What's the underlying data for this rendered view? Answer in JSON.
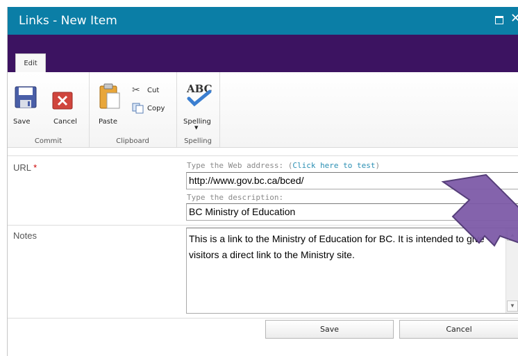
{
  "window": {
    "title": "Links - New Item"
  },
  "ribbon": {
    "tab_edit": "Edit",
    "groups": {
      "commit": {
        "label": "Commit",
        "save": "Save",
        "cancel": "Cancel"
      },
      "clipboard": {
        "label": "Clipboard",
        "paste": "Paste",
        "cut": "Cut",
        "copy": "Copy"
      },
      "spelling": {
        "label": "Spelling",
        "spelling": "Spelling"
      }
    }
  },
  "form": {
    "url": {
      "label": "URL",
      "required_mark": "*",
      "hint_prefix": "Type the Web address: (",
      "hint_link": "Click here to test",
      "hint_suffix": ")",
      "value": "http://www.gov.bc.ca/bced/",
      "desc_hint": "Type the description:",
      "desc_value": "BC Ministry of Education"
    },
    "notes": {
      "label": "Notes",
      "value": "This is a link to the Ministry of Education for BC.  It is intended to give visitors a direct link to the Ministry site."
    },
    "buttons": {
      "save": "Save",
      "cancel": "Cancel"
    }
  },
  "colors": {
    "titlebar": "#0b7ea6",
    "ribbon": "#3c1361",
    "annotation_arrow": "#7e5ba8"
  }
}
